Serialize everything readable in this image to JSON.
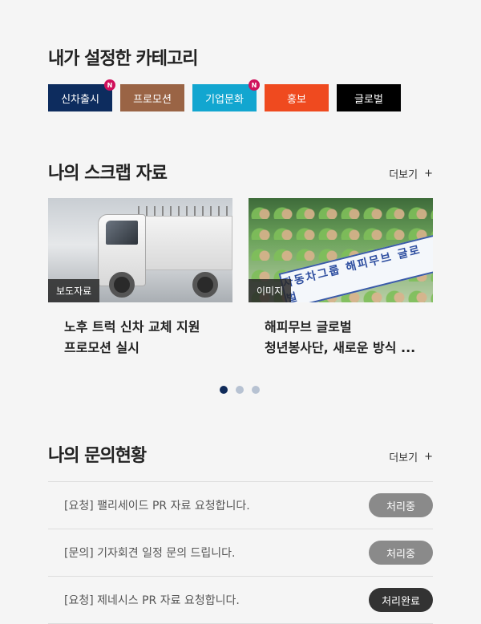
{
  "categories": {
    "title": "내가 설정한 카테고리",
    "items": [
      {
        "label": "신차출시",
        "new": "N",
        "color": "#0d2c5e"
      },
      {
        "label": "프로모션",
        "new": "",
        "color": "#9a6445"
      },
      {
        "label": "기업문화",
        "new": "N",
        "color": "#12a6d0"
      },
      {
        "label": "홍보",
        "new": "",
        "color": "#ef4a1f"
      },
      {
        "label": "글로벌",
        "new": "",
        "color": "#000000"
      }
    ]
  },
  "scrap": {
    "title": "나의 스크랩 자료",
    "more": "더보기",
    "more_icon": "plus-icon",
    "cards": [
      {
        "tag": "보도자료",
        "title_line1": "노후 트럭 신차 교체 지원",
        "title_line2": "프로모션 실시",
        "image": "truck-image"
      },
      {
        "tag": "이미지",
        "title_line1": "해피무브 글로벌",
        "title_line2": "청년봉사단, 새로운 방식 ...",
        "image": "volunteers-image",
        "banner": "자동차그룹 해피무브 글로벌"
      }
    ],
    "pager": {
      "count": 3,
      "active": 0
    }
  },
  "inquiry": {
    "title": "나의 문의현황",
    "more": "더보기",
    "rows": [
      {
        "text": "[요청]  팰리세이드 PR 자료 요청합니다.",
        "status": "처리중",
        "status_color": "#8a8a8a"
      },
      {
        "text": "[문의]  기자회견 일정 문의 드립니다.",
        "status": "처리중",
        "status_color": "#8a8a8a"
      },
      {
        "text": "[요청]  제네시스 PR 자료 요청합니다.",
        "status": "처리완료",
        "status_color": "#333333"
      }
    ]
  }
}
